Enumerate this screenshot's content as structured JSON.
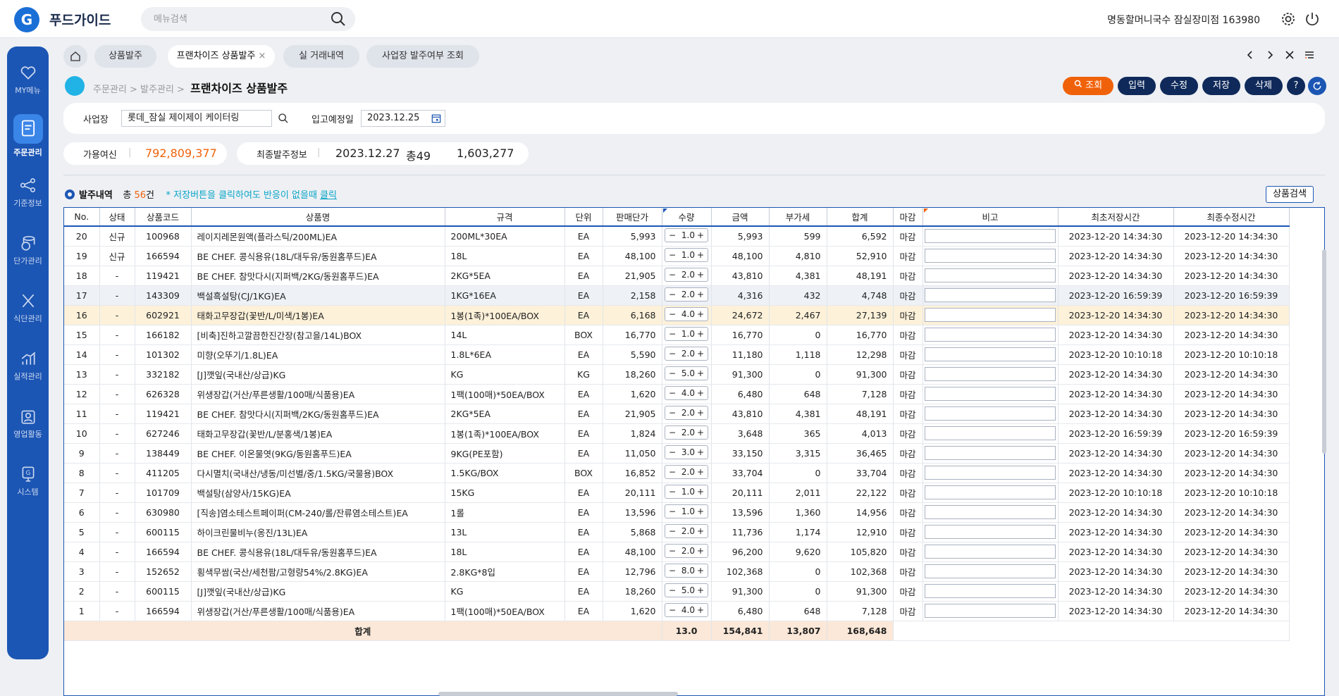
{
  "app": {
    "logo": "G",
    "name": "푸드가이드",
    "search_placeholder": "메뉴검색",
    "store": "명동할머니국수 잠실장미점 163980"
  },
  "sidebar": [
    {
      "label": "MY메뉴",
      "icon": "heart-icon"
    },
    {
      "label": "주문관리",
      "icon": "order-doc-icon",
      "active": true
    },
    {
      "label": "기준정보",
      "icon": "network-icon"
    },
    {
      "label": "단가관리",
      "icon": "coins-icon"
    },
    {
      "label": "식단관리",
      "icon": "utensils-icon"
    },
    {
      "label": "실적관리",
      "icon": "bar-chart-icon"
    },
    {
      "label": "영업활동",
      "icon": "badge-icon"
    },
    {
      "label": "시스템",
      "icon": "system-icon"
    }
  ],
  "tabs": [
    {
      "label": "상품발주"
    },
    {
      "label": "프랜차이즈 상품발주",
      "active": true,
      "close": "×"
    },
    {
      "label": "실 거래내역"
    },
    {
      "label": "사업장 발주여부 조회"
    }
  ],
  "breadcrumb": {
    "l1": "주문관리",
    "l2": "발주관리",
    "current": "프랜차이즈 상품발주",
    "sep": ">"
  },
  "actions": {
    "search": "조회",
    "input": "입력",
    "edit": "수정",
    "save": "저장",
    "delete": "삭제",
    "help": "?"
  },
  "filter": {
    "site_label": "사업장",
    "site_value": "롯데_잠실 제이제이 케이터링",
    "date_label": "입고예정일",
    "date_value": "2023.12.25"
  },
  "credit": {
    "label": "가용여신",
    "value": "792,809,377"
  },
  "last_order": {
    "label": "최종발주정보",
    "date": "2023.12.27",
    "count": "총49",
    "amount": "1,603,277"
  },
  "list": {
    "title": "발주내역",
    "count_prefix": "총 ",
    "count": "56",
    "count_suffix": "건",
    "hint_prefix": "* 저장버튼을 클릭하여도 반응이 없을때 ",
    "hint_link": "클릭",
    "search_button": "상품검색"
  },
  "colors": {
    "accent": "#f0620a",
    "navy": "#0f2a5a",
    "primary": "#1c56b4"
  },
  "columns": [
    "No.",
    "상태",
    "상품코드",
    "상품명",
    "규격",
    "단위",
    "판매단가",
    "수량",
    "금액",
    "부가세",
    "합계",
    "마감",
    "비고",
    "최초저장시간",
    "최종수정시간"
  ],
  "rows": [
    [
      "20",
      "신규",
      "100968",
      "레이지레몬원액(플라스틱/200ML)EA",
      "200ML*30EA",
      "EA",
      "5,993",
      "1.0",
      "5,993",
      "599",
      "6,592",
      "마감",
      "",
      "2023-12-20 14:34:30",
      "2023-12-20 14:34:30"
    ],
    [
      "19",
      "신규",
      "166594",
      "BE CHEF. 콩식용유(18L/대두유/동원홈푸드)EA",
      "18L",
      "EA",
      "48,100",
      "1.0",
      "48,100",
      "4,810",
      "52,910",
      "마감",
      "",
      "2023-12-20 14:34:30",
      "2023-12-20 14:34:30"
    ],
    [
      "18",
      "-",
      "119421",
      "BE CHEF. 참맛다시(지퍼백/2KG/동원홈푸드)EA",
      "2KG*5EA",
      "EA",
      "21,905",
      "2.0",
      "43,810",
      "4,381",
      "48,191",
      "마감",
      "",
      "2023-12-20 14:34:30",
      "2023-12-20 14:34:30"
    ],
    [
      "17",
      "-",
      "143309",
      "백설흑설탕(CJ/1KG)EA",
      "1KG*16EA",
      "EA",
      "2,158",
      "2.0",
      "4,316",
      "432",
      "4,748",
      "마감",
      "",
      "2023-12-20 16:59:39",
      "2023-12-20 16:59:39"
    ],
    [
      "16",
      "-",
      "602921",
      "태화고무장갑(꽃반/L/미색/1봉)EA",
      "1봉(1족)*100EA/BOX",
      "EA",
      "6,168",
      "4.0",
      "24,672",
      "2,467",
      "27,139",
      "마감",
      "",
      "2023-12-20 14:34:30",
      "2023-12-20 14:34:30"
    ],
    [
      "15",
      "-",
      "166182",
      "[비축]진하고깔끔한진간장(참고을/14L)BOX",
      "14L",
      "BOX",
      "16,770",
      "1.0",
      "16,770",
      "0",
      "16,770",
      "마감",
      "",
      "2023-12-20 14:34:30",
      "2023-12-20 14:34:30"
    ],
    [
      "14",
      "-",
      "101302",
      "미향(오뚜기/1.8L)EA",
      "1.8L*6EA",
      "EA",
      "5,590",
      "2.0",
      "11,180",
      "1,118",
      "12,298",
      "마감",
      "",
      "2023-12-20 10:10:18",
      "2023-12-20 10:10:18"
    ],
    [
      "13",
      "-",
      "332182",
      "[J]깻잎(국내산/상급)KG",
      "KG",
      "KG",
      "18,260",
      "5.0",
      "91,300",
      "0",
      "91,300",
      "마감",
      "",
      "2023-12-20 14:34:30",
      "2023-12-20 14:34:30"
    ],
    [
      "12",
      "-",
      "626328",
      "위생장갑(거산/푸른생활/100매/식품용)EA",
      "1팩(100매)*50EA/BOX",
      "EA",
      "1,620",
      "4.0",
      "6,480",
      "648",
      "7,128",
      "마감",
      "",
      "2023-12-20 14:34:30",
      "2023-12-20 14:34:30"
    ],
    [
      "11",
      "-",
      "119421",
      "BE CHEF. 참맛다시(지퍼백/2KG/동원홈푸드)EA",
      "2KG*5EA",
      "EA",
      "21,905",
      "2.0",
      "43,810",
      "4,381",
      "48,191",
      "마감",
      "",
      "2023-12-20 14:34:30",
      "2023-12-20 14:34:30"
    ],
    [
      "10",
      "-",
      "627246",
      "태화고무장갑(꽃반/L/분홍색/1봉)EA",
      "1봉(1족)*100EA/BOX",
      "EA",
      "1,824",
      "2.0",
      "3,648",
      "365",
      "4,013",
      "마감",
      "",
      "2023-12-20 16:59:39",
      "2023-12-20 16:59:39"
    ],
    [
      "9",
      "-",
      "138449",
      "BE CHEF. 이온물엿(9KG/동원홈푸드)EA",
      "9KG(PE포함)",
      "EA",
      "11,050",
      "3.0",
      "33,150",
      "3,315",
      "36,465",
      "마감",
      "",
      "2023-12-20 14:34:30",
      "2023-12-20 14:34:30"
    ],
    [
      "8",
      "-",
      "411205",
      "다시멸치(국내산/냉동/미선별/중/1.5KG/국물용)BOX",
      "1.5KG/BOX",
      "BOX",
      "16,852",
      "2.0",
      "33,704",
      "0",
      "33,704",
      "마감",
      "",
      "2023-12-20 14:34:30",
      "2023-12-20 14:34:30"
    ],
    [
      "7",
      "-",
      "101709",
      "백설탕(삼양사/15KG)EA",
      "15KG",
      "EA",
      "20,111",
      "1.0",
      "20,111",
      "2,011",
      "22,122",
      "마감",
      "",
      "2023-12-20 10:10:18",
      "2023-12-20 10:10:18"
    ],
    [
      "6",
      "-",
      "630980",
      "[직송]염소테스트페이퍼(CM-240/롤/잔류염소테스트)EA",
      "1롤",
      "EA",
      "13,596",
      "1.0",
      "13,596",
      "1,360",
      "14,956",
      "마감",
      "",
      "2023-12-20 14:34:30",
      "2023-12-20 14:34:30"
    ],
    [
      "5",
      "-",
      "600115",
      "하이크린물비누(옹진/13L)EA",
      "13L",
      "EA",
      "5,868",
      "2.0",
      "11,736",
      "1,174",
      "12,910",
      "마감",
      "",
      "2023-12-20 14:34:30",
      "2023-12-20 14:34:30"
    ],
    [
      "4",
      "-",
      "166594",
      "BE CHEF. 콩식용유(18L/대두유/동원홈푸드)EA",
      "18L",
      "EA",
      "48,100",
      "2.0",
      "96,200",
      "9,620",
      "105,820",
      "마감",
      "",
      "2023-12-20 14:34:30",
      "2023-12-20 14:34:30"
    ],
    [
      "3",
      "-",
      "152652",
      "횡색무쌈(국산/세천팜/고형량54%/2.8KG)EA",
      "2.8KG*8입",
      "EA",
      "12,796",
      "8.0",
      "102,368",
      "0",
      "102,368",
      "마감",
      "",
      "2023-12-20 14:34:30",
      "2023-12-20 14:34:30"
    ],
    [
      "2",
      "-",
      "600115",
      "[J]깻잎(국내산/상급)KG",
      "KG",
      "EA",
      "18,260",
      "5.0",
      "91,300",
      "0",
      "91,300",
      "마감",
      "",
      "2023-12-20 14:34:30",
      "2023-12-20 14:34:30"
    ],
    [
      "1",
      "-",
      "166594",
      "위생장갑(거산/푸른생활/100매/식품용)EA",
      "1팩(100매)*50EA/BOX",
      "EA",
      "1,620",
      "4.0",
      "6,480",
      "648",
      "7,128",
      "마감",
      "",
      "2023-12-20 14:34:30",
      "2023-12-20 14:34:30"
    ]
  ],
  "totals": {
    "label": "합계",
    "qty": "13.0",
    "amount": "154,841",
    "vat": "13,807",
    "total": "168,648"
  }
}
